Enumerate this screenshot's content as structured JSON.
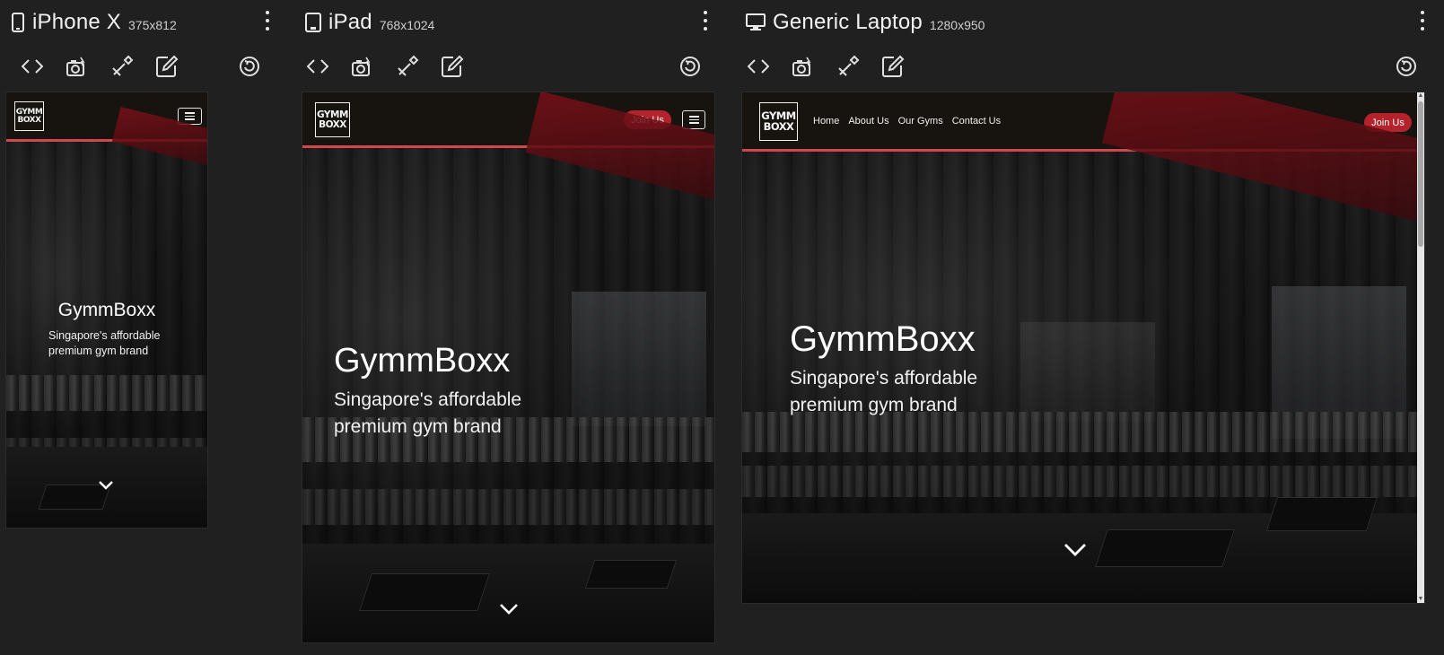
{
  "devices": [
    {
      "icon": "phone-icon",
      "name": "iPhone X",
      "size": "375x812",
      "site": {
        "logo_line1": "GYMM",
        "logo_line2": "BOXX",
        "title": "GymmBoxx",
        "subtitle_line1": "Singapore's affordable",
        "subtitle_line2": "premium gym brand"
      }
    },
    {
      "icon": "tablet-icon",
      "name": "iPad",
      "size": "768x1024",
      "site": {
        "logo_line1": "GYMM",
        "logo_line2": "BOXX",
        "join_label": "Join Us",
        "title": "GymmBoxx",
        "subtitle_line1": "Singapore's affordable",
        "subtitle_line2": "premium gym brand"
      }
    },
    {
      "icon": "laptop-icon",
      "name": "Generic Laptop",
      "size": "1280x950",
      "site": {
        "logo_line1": "GYMM",
        "logo_line2": "BOXX",
        "nav": [
          "Home",
          "About Us",
          "Our Gyms",
          "Contact Us"
        ],
        "join_label": "Join Us",
        "title": "GymmBoxx",
        "subtitle_line1": "Singapore's affordable",
        "subtitle_line2": "premium gym brand"
      }
    }
  ],
  "toolbar_icons": [
    "code-icon",
    "screenshot-icon",
    "inspect-icon",
    "edit-icon",
    "rotate-icon"
  ],
  "colors": {
    "background": "#202020",
    "brand_red": "#b4232c",
    "nav_border": "#d0474f",
    "nav_bg": "#17130f"
  }
}
